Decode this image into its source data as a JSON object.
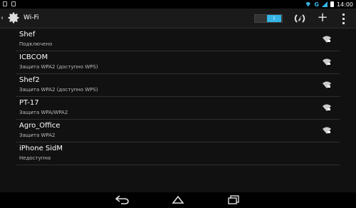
{
  "status_bar": {
    "time": "14:00",
    "network": "G"
  },
  "action_bar": {
    "title": "Wi-Fi",
    "toggle_label": "I"
  },
  "networks": [
    {
      "name": "Shef",
      "status": "Подключено"
    },
    {
      "name": "ICBCOM",
      "status": "Защита WPA2 (доступно WPS)"
    },
    {
      "name": "Shef2",
      "status": "Защита WPA2 (доступно WPS)"
    },
    {
      "name": "PT-17",
      "status": "Защита WPA/WPA2"
    },
    {
      "name": "Agro_Office",
      "status": "Защита WPA2"
    },
    {
      "name": "iPhone SidM",
      "status": "Недоступна"
    }
  ],
  "colors": {
    "accent": "#33b5e5",
    "background": "#111111",
    "actionbar": "#1a1a1a",
    "divider": "#2f2f2f"
  },
  "icons": {
    "wifi_secured": "wifi-lock-icon",
    "settings": "gear-icon",
    "wps": "wps-icon",
    "add": "add-icon",
    "overflow": "overflow-menu-icon",
    "back": "back-icon",
    "home": "home-icon",
    "recents": "recents-icon"
  }
}
